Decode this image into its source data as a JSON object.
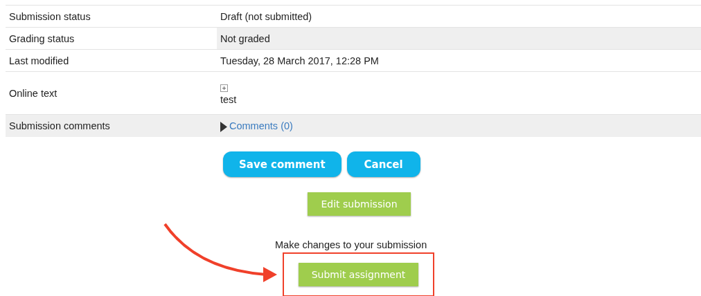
{
  "status_table": [
    {
      "label": "Submission status",
      "value": "Draft (not submitted)",
      "kind": "text",
      "label_shaded": false,
      "value_shaded": false
    },
    {
      "label": "Grading status",
      "value": "Not graded",
      "kind": "text",
      "label_shaded": false,
      "value_shaded": true
    },
    {
      "label": "Last modified",
      "value": "Tuesday, 28 March 2017, 12:28 PM",
      "kind": "text",
      "label_shaded": false,
      "value_shaded": false
    },
    {
      "label": "Online text",
      "value": "test",
      "kind": "expandable",
      "label_shaded": false,
      "value_shaded": false
    },
    {
      "label": "Submission comments",
      "value": "Comments (0)",
      "kind": "link",
      "label_shaded": true,
      "value_shaded": true
    }
  ],
  "comment_buttons": [
    "Save comment",
    "Cancel"
  ],
  "edit_button": "Edit submission",
  "submit_hint": "Make changes to your submission",
  "submit_button": "Submit assignment"
}
